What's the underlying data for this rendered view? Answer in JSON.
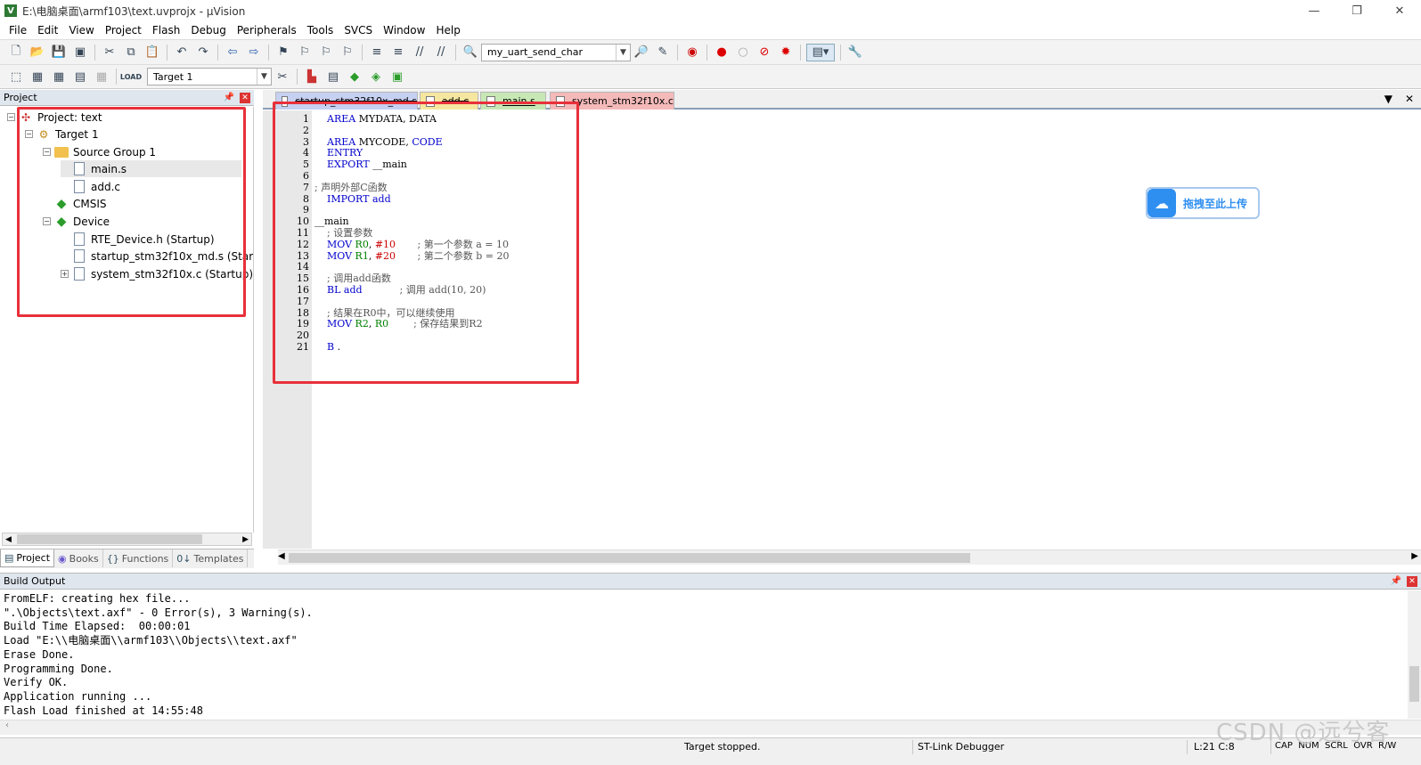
{
  "window": {
    "title": "E:\\电脑桌面\\armf103\\text.uvprojx - µVision",
    "icon_letter": "V",
    "minimize": "—",
    "restore": "❐",
    "close": "✕"
  },
  "menu": [
    "File",
    "Edit",
    "View",
    "Project",
    "Flash",
    "Debug",
    "Peripherals",
    "Tools",
    "SVCS",
    "Window",
    "Help"
  ],
  "toolbar": {
    "function_combo": "my_uart_send_char",
    "target_combo": "Target 1"
  },
  "project_panel": {
    "title": "Project",
    "tree": [
      {
        "label": "Project: text",
        "indent": 0,
        "expander": "−",
        "icon": "project"
      },
      {
        "label": "Target 1",
        "indent": 1,
        "expander": "−",
        "icon": "target"
      },
      {
        "label": "Source Group 1",
        "indent": 2,
        "expander": "−",
        "icon": "folder"
      },
      {
        "label": "main.s",
        "indent": 3,
        "expander": "",
        "icon": "file",
        "selected": true
      },
      {
        "label": "add.c",
        "indent": 3,
        "expander": "",
        "icon": "file"
      },
      {
        "label": "CMSIS",
        "indent": 2,
        "expander": "",
        "icon": "diamond"
      },
      {
        "label": "Device",
        "indent": 2,
        "expander": "−",
        "icon": "diamond"
      },
      {
        "label": "RTE_Device.h (Startup)",
        "indent": 3,
        "expander": "",
        "icon": "file"
      },
      {
        "label": "startup_stm32f10x_md.s (Startup)",
        "indent": 3,
        "expander": "",
        "icon": "file"
      },
      {
        "label": "system_stm32f10x.c (Startup)",
        "indent": 3,
        "expander": "+",
        "icon": "file"
      }
    ],
    "tabs": [
      "Project",
      "Books",
      "Functions",
      "Templates"
    ]
  },
  "editor": {
    "tabs": [
      {
        "label": "startup_stm32f10x_md.s",
        "color": "#c6d0f0"
      },
      {
        "label": "add.c",
        "color": "#f5e7a0"
      },
      {
        "label": "main.s",
        "color": "#c7e8b5"
      },
      {
        "label": "system_stm32f10x.c",
        "color": "#f4b9b9"
      }
    ],
    "code": [
      "    AREA MYDATA, DATA",
      "",
      "    AREA MYCODE, CODE",
      "    ENTRY",
      "    EXPORT __main",
      "",
      "; 声明外部C函数",
      "    IMPORT add",
      "",
      "__main",
      "    ; 设置参数",
      "    MOV R0, #10       ; 第一个参数 a = 10",
      "    MOV R1, #20       ; 第二个参数 b = 20",
      "",
      "    ; 调用add函数",
      "    BL add            ; 调用 add(10, 20)",
      "",
      "    ; 结果在R0中，可以继续使用",
      "    MOV R2, R0        ; 保存结果到R2",
      "",
      "    B ."
    ]
  },
  "upload_button": {
    "label": "拖拽至此上传"
  },
  "build_output": {
    "title": "Build Output",
    "lines": [
      "FromELF: creating hex file...",
      "\".\\Objects\\text.axf\" - 0 Error(s), 3 Warning(s).",
      "Build Time Elapsed:  00:00:01",
      "Load \"E:\\\\电脑桌面\\\\armf103\\\\Objects\\\\text.axf\"",
      "Erase Done.",
      "Programming Done.",
      "Verify OK.",
      "Application running ...",
      "Flash Load finished at 14:55:48"
    ]
  },
  "status": {
    "target": "Target stopped.",
    "debugger": "ST-Link Debugger",
    "cursor": "L:21 C:8",
    "flags": "CAP  NUM  SCRL  OVR  R/W"
  },
  "watermark": "CSDN @远兮客"
}
